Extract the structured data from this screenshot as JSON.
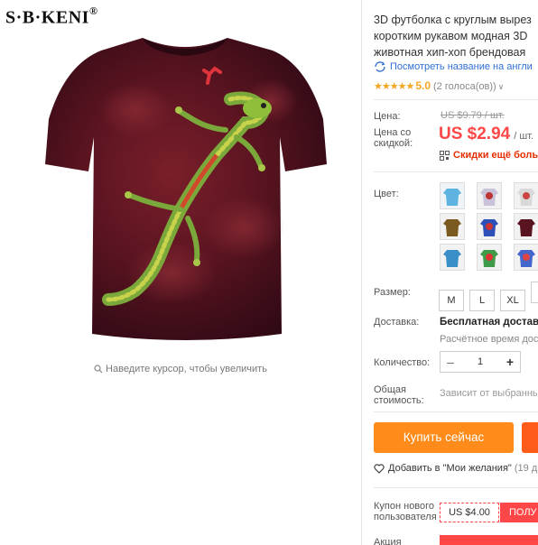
{
  "gallery": {
    "brand": "S·B·KENI",
    "brand_mark": "®",
    "zoom_hint": "Наведите курсор, чтобы увеличить"
  },
  "product": {
    "title_lines": [
      "3D футболка с круглым вырез",
      "коротким рукавом модная 3D",
      "животная хип-хоп брендовая"
    ],
    "translate_link": "Посмотреть название на англи",
    "rating": {
      "stars": "★★★★★",
      "score": "5.0",
      "votes": "(2 голоса(ов))"
    }
  },
  "price": {
    "label": "Цена:",
    "original": "US $9.79 / шт.",
    "sale_label_1": "Цена со",
    "sale_label_2": "скидкой:",
    "sale_value": "US $2.94",
    "sale_unit": "/ шт.",
    "discount_text": "Скидки ещё больш"
  },
  "options": {
    "color_label": "Цвет:",
    "size_label": "Размер:",
    "sizes": [
      "M",
      "L",
      "XL"
    ]
  },
  "shipping": {
    "label": "Доставка:",
    "value": "Бесплатная доставка",
    "sub": "Расчётное время дост"
  },
  "quantity": {
    "label": "Количество:",
    "value": "1",
    "minus": "–",
    "plus": "+"
  },
  "total": {
    "label_1": "Общая",
    "label_2": "стоимость:",
    "value": "Зависит от выбранны"
  },
  "actions": {
    "buy_now": "Купить сейчас",
    "wishlist": "Добавить в \"Мои желания\"",
    "wishlist_count": "(19 д"
  },
  "coupon": {
    "label_1": "Купон нового",
    "label_2": "пользователя",
    "amount": "US $4.00",
    "get": "ПОЛУ"
  },
  "promo": {
    "label": "Акция"
  },
  "colors": {
    "accent_red": "#ff4747",
    "buy_orange": "#ff8c1a",
    "star_gold": "#f5a623",
    "link_blue": "#2f6fd1"
  }
}
